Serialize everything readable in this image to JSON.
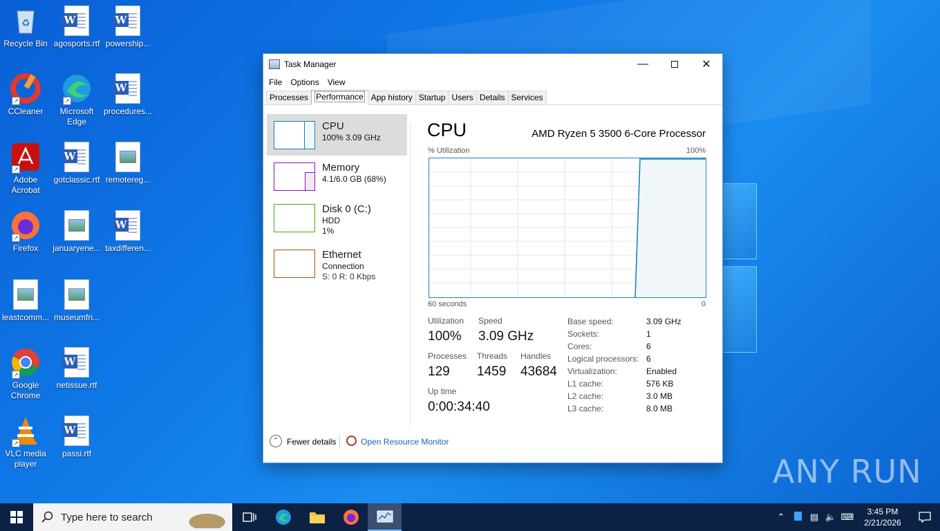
{
  "desktop": {
    "icons": [
      {
        "label": "Recycle Bin",
        "icon": "recycle-bin-icon"
      },
      {
        "label": "agosports.rtf",
        "icon": "word-doc-icon"
      },
      {
        "label": "powership...",
        "icon": "word-doc-icon"
      },
      {
        "label": "CCleaner",
        "icon": "ccleaner-icon"
      },
      {
        "label": "Microsoft Edge",
        "icon": "edge-icon"
      },
      {
        "label": "procedures...",
        "icon": "word-doc-icon"
      },
      {
        "label": "Adobe Acrobat",
        "icon": "acrobat-icon"
      },
      {
        "label": "gotclassic.rtf",
        "icon": "word-doc-icon"
      },
      {
        "label": "remotereg...",
        "icon": "image-file-icon"
      },
      {
        "label": "Firefox",
        "icon": "firefox-icon"
      },
      {
        "label": "januaryene...",
        "icon": "image-file-icon"
      },
      {
        "label": "taxdifferen...",
        "icon": "word-doc-icon"
      },
      {
        "label": "leastcomm...",
        "icon": "image-file-icon"
      },
      {
        "label": "museumfri...",
        "icon": "image-file-icon"
      },
      {
        "label": "Google Chrome",
        "icon": "chrome-icon"
      },
      {
        "label": "netissue.rtf",
        "icon": "word-doc-icon"
      },
      {
        "label": "VLC media player",
        "icon": "vlc-icon"
      },
      {
        "label": "passi.rtf",
        "icon": "word-doc-icon"
      }
    ]
  },
  "task_manager": {
    "title": "Task Manager",
    "menu": [
      "File",
      "Options",
      "View"
    ],
    "tabs": [
      "Processes",
      "Performance",
      "App history",
      "Startup",
      "Users",
      "Details",
      "Services"
    ],
    "active_tab": "Performance",
    "sidebar": [
      {
        "name": "CPU",
        "line1": "100% 3.09 GHz",
        "line2": "",
        "color": "#117dbb"
      },
      {
        "name": "Memory",
        "line1": "4.1/6.0 GB (68%)",
        "line2": "",
        "color": "#8b12ae"
      },
      {
        "name": "Disk 0 (C:)",
        "line1": "HDD",
        "line2": "1%",
        "color": "#4da60c"
      },
      {
        "name": "Ethernet",
        "line1": "Connection",
        "line2": "S: 0 R: 0 Kbps",
        "color": "#a74f01"
      }
    ],
    "main": {
      "title": "CPU",
      "processor": "AMD Ryzen 5 3500 6-Core Processor",
      "util_label": "% Utilization",
      "util_max": "100%",
      "time_label": "60 seconds",
      "time_zero": "0",
      "stats": {
        "utilization_label": "Utilization",
        "utilization": "100%",
        "speed_label": "Speed",
        "speed": "3.09 GHz",
        "processes_label": "Processes",
        "processes": "129",
        "threads_label": "Threads",
        "threads": "1459",
        "handles_label": "Handles",
        "handles": "43684",
        "uptime_label": "Up time",
        "uptime": "0:00:34:40"
      },
      "details": [
        {
          "k": "Base speed:",
          "v": "3.09 GHz"
        },
        {
          "k": "Sockets:",
          "v": "1"
        },
        {
          "k": "Cores:",
          "v": "6"
        },
        {
          "k": "Logical processors:",
          "v": "6"
        },
        {
          "k": "Virtualization:",
          "v": "Enabled"
        },
        {
          "k": "L1 cache:",
          "v": "576 KB"
        },
        {
          "k": "L2 cache:",
          "v": "3.0 MB"
        },
        {
          "k": "L3 cache:",
          "v": "8.0 MB"
        }
      ]
    },
    "footer": {
      "fewer": "Fewer details",
      "resource_monitor": "Open Resource Monitor"
    }
  },
  "taskbar": {
    "search_placeholder": "Type here to search",
    "clock_time": "3:45 PM",
    "clock_date": "2/21/2026"
  },
  "watermark": "ANY RUN"
}
